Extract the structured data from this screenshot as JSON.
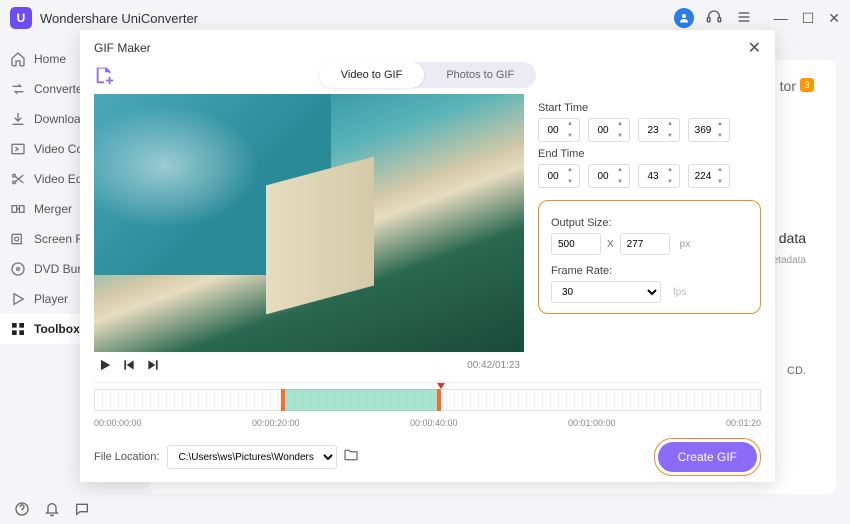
{
  "app": {
    "title": "Wondershare UniConverter"
  },
  "sidebar": {
    "items": [
      {
        "label": "Home"
      },
      {
        "label": "Converter"
      },
      {
        "label": "Downloader"
      },
      {
        "label": "Video Compressor"
      },
      {
        "label": "Video Editor"
      },
      {
        "label": "Merger"
      },
      {
        "label": "Screen Recorder"
      },
      {
        "label": "DVD Burner"
      },
      {
        "label": "Player"
      },
      {
        "label": "Toolbox"
      }
    ]
  },
  "bg": {
    "title_suffix": "tor",
    "badge": "3",
    "data_label": "data",
    "data_sub": "etadata",
    "cd_suffix": "CD."
  },
  "gif": {
    "modal_title": "GIF Maker",
    "modes": {
      "video": "Video to GIF",
      "photos": "Photos to GIF"
    },
    "start_label": "Start Time",
    "end_label": "End Time",
    "start": {
      "h": "00",
      "m": "00",
      "s": "23",
      "ms": "369"
    },
    "end": {
      "h": "00",
      "m": "00",
      "s": "43",
      "ms": "224"
    },
    "output_size_label": "Output Size:",
    "width": "500",
    "height": "277",
    "x": "X",
    "px": "px",
    "frame_rate_label": "Frame Rate:",
    "frame_rate": "30",
    "fps": "fps",
    "time_current": "00:42",
    "time_total": "01:23",
    "timeline": {
      "labels": [
        "00:00:00:00",
        "00:00:20:00",
        "00:00:40:00",
        "00:01:00:00",
        "00:01:20"
      ],
      "sel_left_pct": 28,
      "sel_width_pct": 24,
      "playhead_pct": 52
    },
    "file_location_label": "File Location:",
    "file_location": "C:\\Users\\ws\\Pictures\\Wonders",
    "create_btn": "Create GIF"
  }
}
